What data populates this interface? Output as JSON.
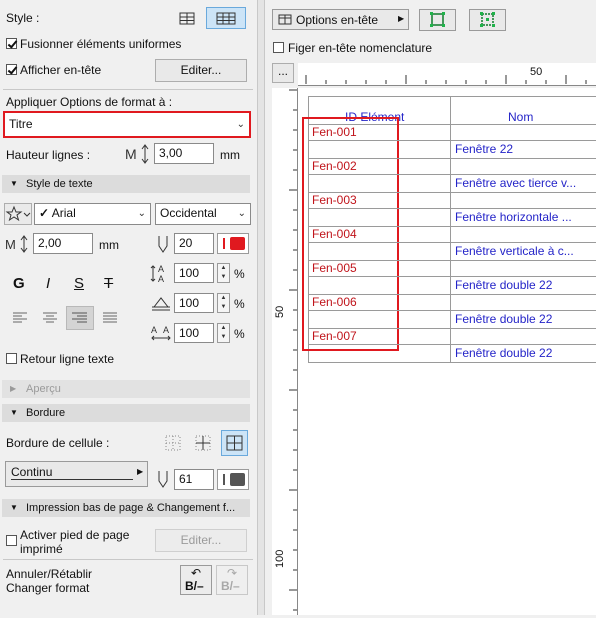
{
  "left": {
    "style_label": "Style :",
    "merge_label": "Fusionner éléments uniformes",
    "merge_checked": true,
    "show_header_label": "Afficher en-tête",
    "show_header_checked": true,
    "edit_button": "Editer...",
    "apply_label": "Appliquer Options de format à :",
    "apply_value": "Titre",
    "row_height_label": "Hauteur lignes :",
    "row_height_value": "3,00",
    "row_height_unit": "mm",
    "text_style_section": "Style de texte",
    "font_value": "Arial",
    "encoding_value": "Occidental",
    "text_size_value": "2,00",
    "text_size_unit": "mm",
    "pen_value": "20",
    "bold": "G",
    "italic": "I",
    "underline": "S",
    "strike": "T",
    "width_value": "100",
    "spacing_value": "100",
    "char_spacing_value": "100",
    "percent": "%",
    "wrap_label": "Retour ligne texte",
    "preview_section": "Aperçu",
    "border_section": "Bordure",
    "cell_border_label": "Bordure de cellule :",
    "line_type_value": "Continu",
    "border_pen_value": "61",
    "print_section": "Impression bas de page & Changement f...",
    "footer_label_1": "Activer pied de page",
    "footer_label_2": "imprimé",
    "footer_edit_button": "Editer...",
    "undo_label_1": "Annuler/Rétablir",
    "undo_label_2": "Changer format",
    "undo_icon_text": "B/–",
    "redo_icon_text": "B/–",
    "pen_color": "#e0191f",
    "border_pen_color": "#555555"
  },
  "right": {
    "options_button": "Options en-tête",
    "freeze_label": "Figer en-tête nomenclature",
    "ruler_button": "...",
    "ruler_top_mark": "50",
    "ruler_left_mark_1": "50",
    "ruler_left_mark_2": "100",
    "col_id_header": "ID Elément",
    "col_nom_header": "Nom",
    "rows": [
      {
        "id": "Fen-001",
        "nom": "Fenêtre 22"
      },
      {
        "id": "Fen-002",
        "nom": "Fenêtre avec tierce v..."
      },
      {
        "id": "Fen-003",
        "nom": "Fenêtre horizontale ..."
      },
      {
        "id": "Fen-004",
        "nom": "Fenêtre verticale à c..."
      },
      {
        "id": "Fen-005",
        "nom": "Fenêtre double 22"
      },
      {
        "id": "Fen-006",
        "nom": "Fenêtre double 22"
      },
      {
        "id": "Fen-007",
        "nom": "Fenêtre double 22"
      }
    ],
    "id_color": "#c0141b",
    "nom_color": "#2424c8",
    "highlight_color": "#e0191f"
  }
}
